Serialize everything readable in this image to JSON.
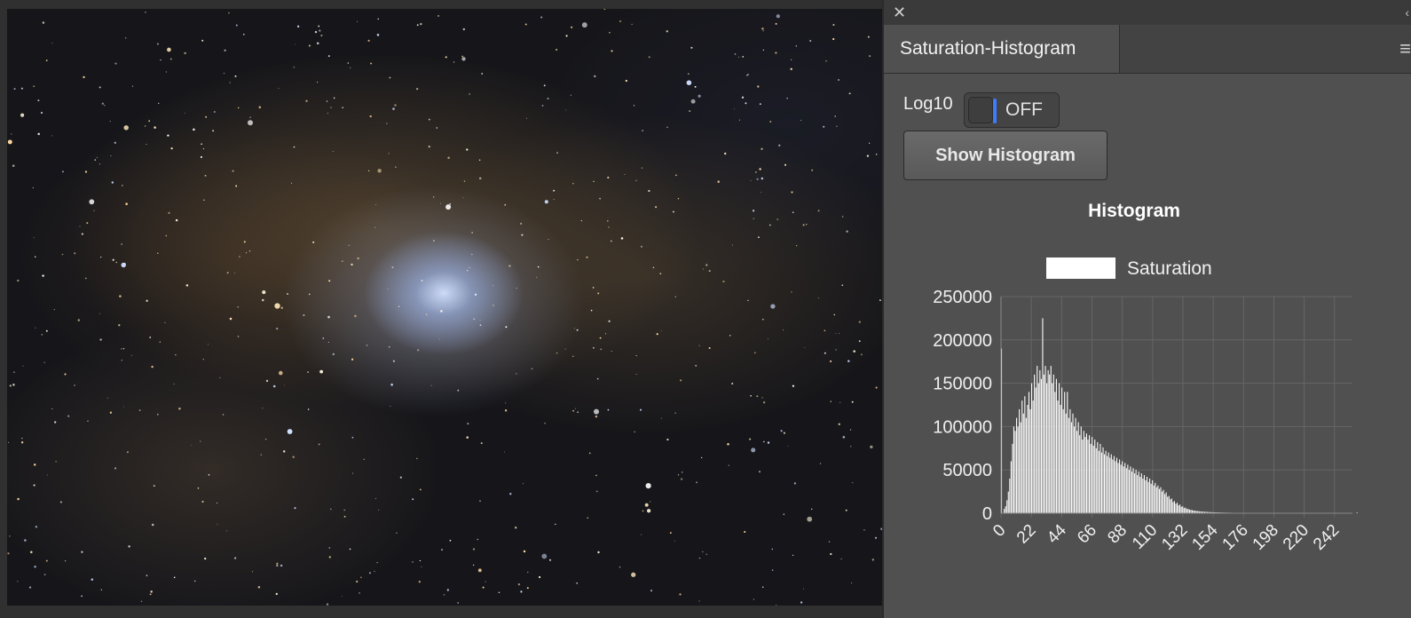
{
  "image": {
    "description_icon": "nebula-photo"
  },
  "panel": {
    "close_icon": "close-icon",
    "tab_title": "Saturation-Histogram",
    "menu_icon": "menu-icon",
    "log_label": "Log10",
    "toggle_state": "OFF",
    "show_button": "Show Histogram",
    "accent_color": "#3d7bff"
  },
  "chart_data": {
    "type": "bar",
    "title": "Histogram",
    "legend": [
      "Saturation"
    ],
    "legend_position": "top",
    "grid": true,
    "ylim": [
      0,
      250000
    ],
    "yticks": [
      "250000",
      "200000",
      "150000",
      "100000",
      "50000",
      "0"
    ],
    "xticks": [
      "0",
      "22",
      "44",
      "66",
      "88",
      "110",
      "132",
      "154",
      "176",
      "198",
      "220",
      "242"
    ],
    "xlim": [
      0,
      255
    ],
    "series": [
      {
        "name": "Saturation",
        "values": [
          190000,
          0,
          5000,
          8000,
          15000,
          25000,
          40000,
          60000,
          80000,
          100000,
          95000,
          110000,
          100000,
          120000,
          105000,
          130000,
          115000,
          135000,
          110000,
          125000,
          140000,
          120000,
          150000,
          130000,
          160000,
          145000,
          170000,
          150000,
          165000,
          155000,
          225000,
          160000,
          170000,
          150000,
          165000,
          160000,
          170000,
          150000,
          160000,
          140000,
          155000,
          130000,
          150000,
          125000,
          145000,
          120000,
          140000,
          115000,
          140000,
          110000,
          120000,
          105000,
          115000,
          100000,
          110000,
          95000,
          105000,
          90000,
          100000,
          85000,
          95000,
          88000,
          92000,
          85000,
          90000,
          80000,
          88000,
          78000,
          85000,
          75000,
          82000,
          72000,
          80000,
          70000,
          76000,
          68000,
          72000,
          66000,
          70000,
          64000,
          68000,
          62000,
          66000,
          60000,
          64000,
          58000,
          62000,
          56000,
          60000,
          54000,
          58000,
          52000,
          56000,
          50000,
          54000,
          48000,
          52000,
          46000,
          50000,
          44000,
          48000,
          42000,
          46000,
          40000,
          44000,
          38000,
          42000,
          36000,
          40000,
          34000,
          38000,
          32000,
          35000,
          30000,
          32000,
          28000,
          30000,
          25000,
          27000,
          22000,
          24000,
          19000,
          20000,
          16000,
          17000,
          13000,
          14000,
          11000,
          12000,
          9000,
          10000,
          7500,
          8000,
          6000,
          6500,
          5000,
          5000,
          4000,
          4000,
          3500,
          3000,
          3000,
          2500,
          2500,
          2200,
          2000,
          2000,
          1800,
          1700,
          1600,
          1500,
          1400,
          1300,
          1200,
          1200,
          1100,
          1000,
          1000,
          900,
          900,
          850,
          800,
          750,
          700,
          700,
          650,
          600,
          600,
          550,
          500,
          500,
          480,
          450,
          420,
          400,
          380,
          360,
          340,
          320,
          300,
          290,
          280,
          270,
          260,
          250,
          240,
          230,
          220,
          210,
          200,
          195,
          190,
          185,
          180,
          175,
          170,
          165,
          160,
          155,
          150,
          145,
          140,
          135,
          130,
          125,
          120,
          115,
          110,
          105,
          100,
          98,
          96,
          94,
          92,
          90,
          88,
          86,
          84,
          82,
          80,
          78,
          76,
          74,
          72,
          70,
          68,
          66,
          64,
          62,
          60,
          58,
          56,
          54,
          52,
          50,
          48,
          46,
          44,
          42,
          40,
          38,
          36,
          34,
          32,
          30,
          28,
          26,
          24,
          22,
          20,
          18,
          16,
          14,
          12,
          10,
          8,
          6,
          4,
          2,
          800
        ]
      }
    ]
  }
}
